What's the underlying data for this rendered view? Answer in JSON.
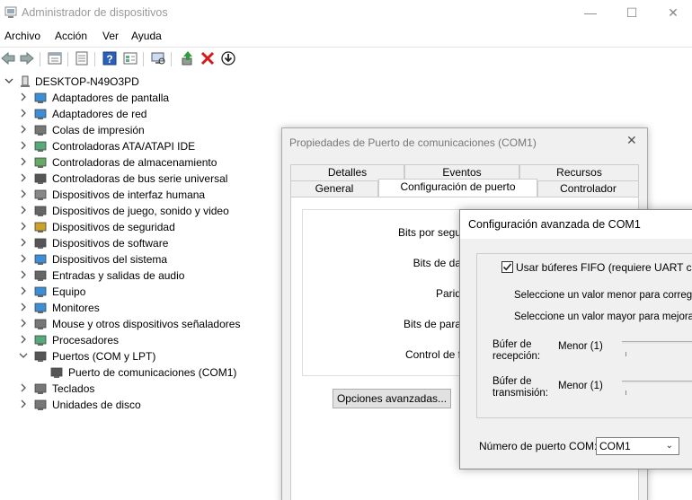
{
  "window": {
    "title": "Administrador de dispositivos"
  },
  "menu": [
    "Archivo",
    "Acción",
    "Ver",
    "Ayuda"
  ],
  "tree": {
    "root": "DESKTOP-N49O3PD",
    "items": [
      {
        "label": "Adaptadores de pantalla",
        "icon": "display-adapter-icon"
      },
      {
        "label": "Adaptadores de red",
        "icon": "network-adapter-icon"
      },
      {
        "label": "Colas de impresión",
        "icon": "printer-icon"
      },
      {
        "label": "Controladoras ATA/ATAPI IDE",
        "icon": "ide-controller-icon"
      },
      {
        "label": "Controladoras de almacenamiento",
        "icon": "storage-controller-icon"
      },
      {
        "label": "Controladoras de bus serie universal",
        "icon": "usb-icon"
      },
      {
        "label": "Dispositivos de interfaz humana",
        "icon": "hid-icon"
      },
      {
        "label": "Dispositivos de juego, sonido y video",
        "icon": "speaker-icon"
      },
      {
        "label": "Dispositivos de seguridad",
        "icon": "key-icon"
      },
      {
        "label": "Dispositivos de software",
        "icon": "software-device-icon"
      },
      {
        "label": "Dispositivos del sistema",
        "icon": "system-device-icon"
      },
      {
        "label": "Entradas y salidas de audio",
        "icon": "audio-icon"
      },
      {
        "label": "Equipo",
        "icon": "computer-icon"
      },
      {
        "label": "Monitores",
        "icon": "monitor-icon"
      },
      {
        "label": "Mouse y otros dispositivos señaladores",
        "icon": "mouse-icon"
      },
      {
        "label": "Procesadores",
        "icon": "cpu-icon"
      },
      {
        "label": "Puertos (COM y LPT)",
        "icon": "port-icon",
        "expanded": true
      },
      {
        "label": "Puerto de comunicaciones (COM1)",
        "icon": "com-port-icon",
        "child": true
      },
      {
        "label": "Teclados",
        "icon": "keyboard-icon"
      },
      {
        "label": "Unidades de disco",
        "icon": "disk-icon"
      }
    ]
  },
  "properties": {
    "title": "Propiedades de Puerto de comunicaciones (COM1)",
    "tabs_top": [
      "Detalles",
      "Eventos",
      "Recursos"
    ],
    "tabs_bottom": [
      "General",
      "Configuración de puerto",
      "Controlador"
    ],
    "active_tab": "Configuración de puerto",
    "fields": [
      "Bits por segu",
      "Bits de da",
      "Parid",
      "Bits de para",
      "Control de f"
    ],
    "advanced_button": "Opciones avanzadas..."
  },
  "advanced": {
    "title": "Configuración avanzada de COM1",
    "fifo_label": "Usar búferes FIFO (requiere UART compa",
    "fifo_checked": true,
    "hint_lower": "Seleccione un valor menor para corregir p",
    "hint_higher": "Seleccione un valor mayor para mejorar el",
    "rx_label": "Búfer de recepción:",
    "rx_min": "Menor (1)",
    "tx_label": "Búfer de transmisión:",
    "tx_min": "Menor (1)",
    "com_label": "Número de puerto COM:",
    "com_value": "COM1"
  }
}
